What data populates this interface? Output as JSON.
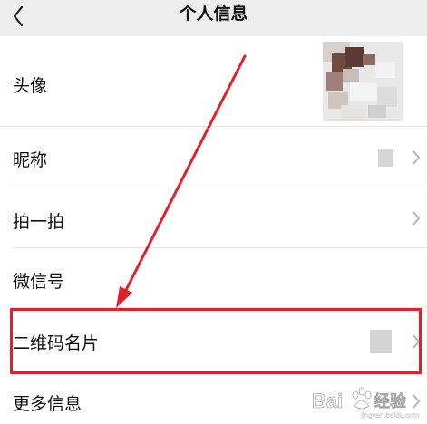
{
  "header": {
    "title": "个人信息",
    "back_icon": "chevron-left-icon"
  },
  "rows": [
    {
      "label": "头像",
      "right": "avatar"
    },
    {
      "label": "昵称",
      "right": "blurred-value"
    },
    {
      "label": "拍一拍",
      "right": "chevron"
    },
    {
      "label": "微信号",
      "right": "none"
    },
    {
      "label": "二维码名片",
      "right": "blurred-qr"
    },
    {
      "label": "更多信息",
      "right": "chevron"
    }
  ],
  "annotation": {
    "highlight_color": "#e0202b",
    "arrow_color": "#e0202b"
  },
  "watermark": {
    "text": "Bai 经验",
    "subtext": "jingyan.baidu.com"
  },
  "colors": {
    "nav_background": "#ededed",
    "divider": "#e6e6e6",
    "chevron": "#b2b2b2"
  }
}
